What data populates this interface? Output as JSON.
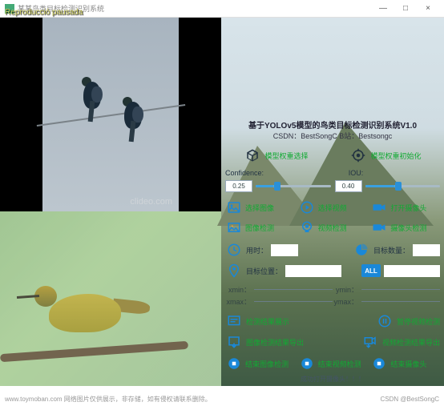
{
  "window": {
    "title_fragment": "某某鸟类目标检测识别系统",
    "overlay": "Reproducció pausada",
    "min": "—",
    "max": "□",
    "close": "×"
  },
  "left": {
    "top_watermark": "clideo.com"
  },
  "header": {
    "title": "基于YOLOv5模型的鸟类目标检测识别系统V1.0",
    "subtitle": "CSDN：BestSongC   B站：Bestsongc"
  },
  "weights": {
    "select": "模型权重选择",
    "init": "模型权重初始化"
  },
  "sliders": {
    "conf_label": "Confidence:",
    "conf_val": "0.25",
    "conf_pct": 25,
    "iou_label": "IOU:",
    "iou_val": "0.40",
    "iou_pct": 40
  },
  "sources": {
    "img": "选择图像",
    "vid": "选择视频",
    "cam": "打开摄像头",
    "img_det": "图像检测",
    "vid_det": "视频检测",
    "cam_det": "摄像头检测"
  },
  "stats": {
    "time": "用时：",
    "count": "目标数量：",
    "pos": "目标位置：",
    "all": "ALL"
  },
  "coords": {
    "xmin": "xmin：",
    "ymin": "ymin：",
    "xmax": "xmax：",
    "ymax": "ymax："
  },
  "actions": {
    "show_res": "检测结果展示",
    "pause_vid": "暂停视频检测",
    "export_img": "图像检测结果导出",
    "export_vid": "视频检测结果导出",
    "end_img": "结束图像检测",
    "end_vid": "结束视频检测",
    "end_cam": "结束摄像头"
  },
  "footer": "成功打开摄像头！！！",
  "bottom": {
    "left": "www.toymoban.com 网络图片仅供展示，非存储，如有侵权请联系删除。",
    "right": "CSDN @BestSongC"
  },
  "colors": {
    "blue": "#1a88d8",
    "dark": "#203040"
  }
}
